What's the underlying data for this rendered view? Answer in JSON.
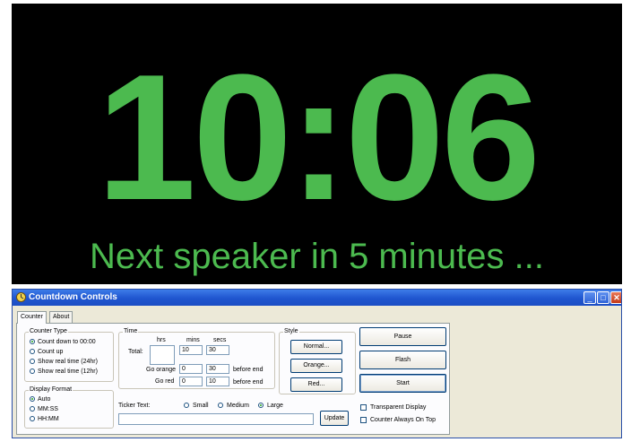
{
  "display": {
    "time": "10:06",
    "ticker_text": "Next speaker in 5 minutes ...",
    "text_color": "#4cba4f",
    "background": "#000000"
  },
  "window": {
    "title": "Countdown Controls",
    "controls": {
      "minimize": "minimize-icon",
      "maximize": "maximize-icon",
      "close": "close-icon"
    }
  },
  "tabs": [
    "Counter",
    "About"
  ],
  "counter_type": {
    "label": "Counter Type",
    "options": [
      "Count down to 00:00",
      "Count up",
      "Show real time (24hr)",
      "Show real time (12hr)"
    ],
    "selected": 0
  },
  "display_format": {
    "label": "Display Format",
    "options": [
      "Auto",
      "MM:SS",
      "HH:MM"
    ],
    "selected": 0
  },
  "time": {
    "label": "Time",
    "col_headers": [
      "hrs",
      "mins",
      "secs"
    ],
    "total_label": "Total:",
    "total": {
      "hrs": "",
      "mins": "10",
      "secs": "30"
    },
    "go_orange_label": "Go orange",
    "go_orange": {
      "mins": "0",
      "secs": "30"
    },
    "go_red_label": "Go red",
    "go_red": {
      "mins": "0",
      "secs": "10"
    },
    "before_end": "before end"
  },
  "style": {
    "label": "Style",
    "buttons": [
      "Normal...",
      "Orange...",
      "Red..."
    ]
  },
  "actions": {
    "pause": "Pause",
    "flash": "Flash",
    "start": "Start"
  },
  "ticker": {
    "label": "Ticker Text:",
    "sizes": [
      "Small",
      "Medium",
      "Large"
    ],
    "selected_size": 2,
    "value": "",
    "update": "Update"
  },
  "options": {
    "transparent_display": "Transparent Display",
    "always_on_top": "Counter Always On Top"
  }
}
